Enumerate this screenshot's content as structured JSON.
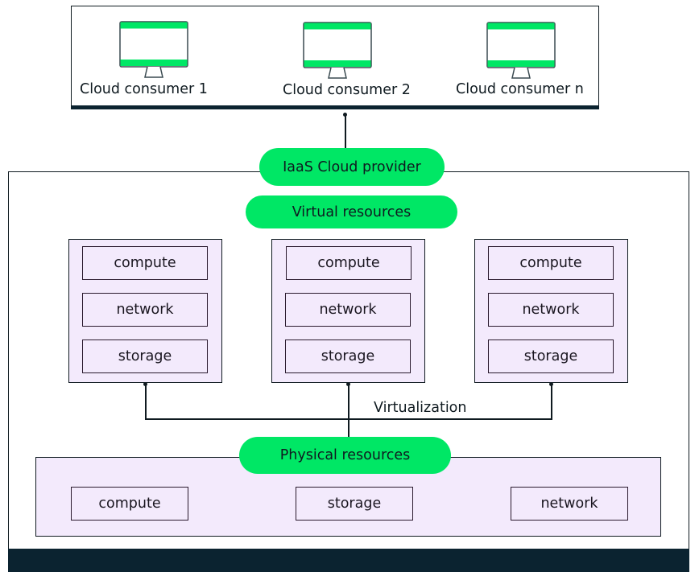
{
  "consumers": [
    {
      "label": "Cloud consumer 1",
      "icon": "monitor-icon"
    },
    {
      "label": "Cloud consumer 2",
      "icon": "monitor-icon"
    },
    {
      "label": "Cloud consumer n",
      "icon": "monitor-icon"
    }
  ],
  "provider": {
    "label": "IaaS Cloud provider"
  },
  "virtual": {
    "label": "Virtual resources",
    "groups": [
      {
        "items": [
          "compute",
          "network",
          "storage"
        ]
      },
      {
        "items": [
          "compute",
          "network",
          "storage"
        ]
      },
      {
        "items": [
          "compute",
          "network",
          "storage"
        ]
      }
    ]
  },
  "virtualization_label": "Virtualization",
  "physical": {
    "label": "Physical resources",
    "items": [
      "compute",
      "storage",
      "network"
    ]
  },
  "colors": {
    "accent": "#00e765",
    "dark": "#0b2330",
    "panel": "#f3eafc"
  }
}
